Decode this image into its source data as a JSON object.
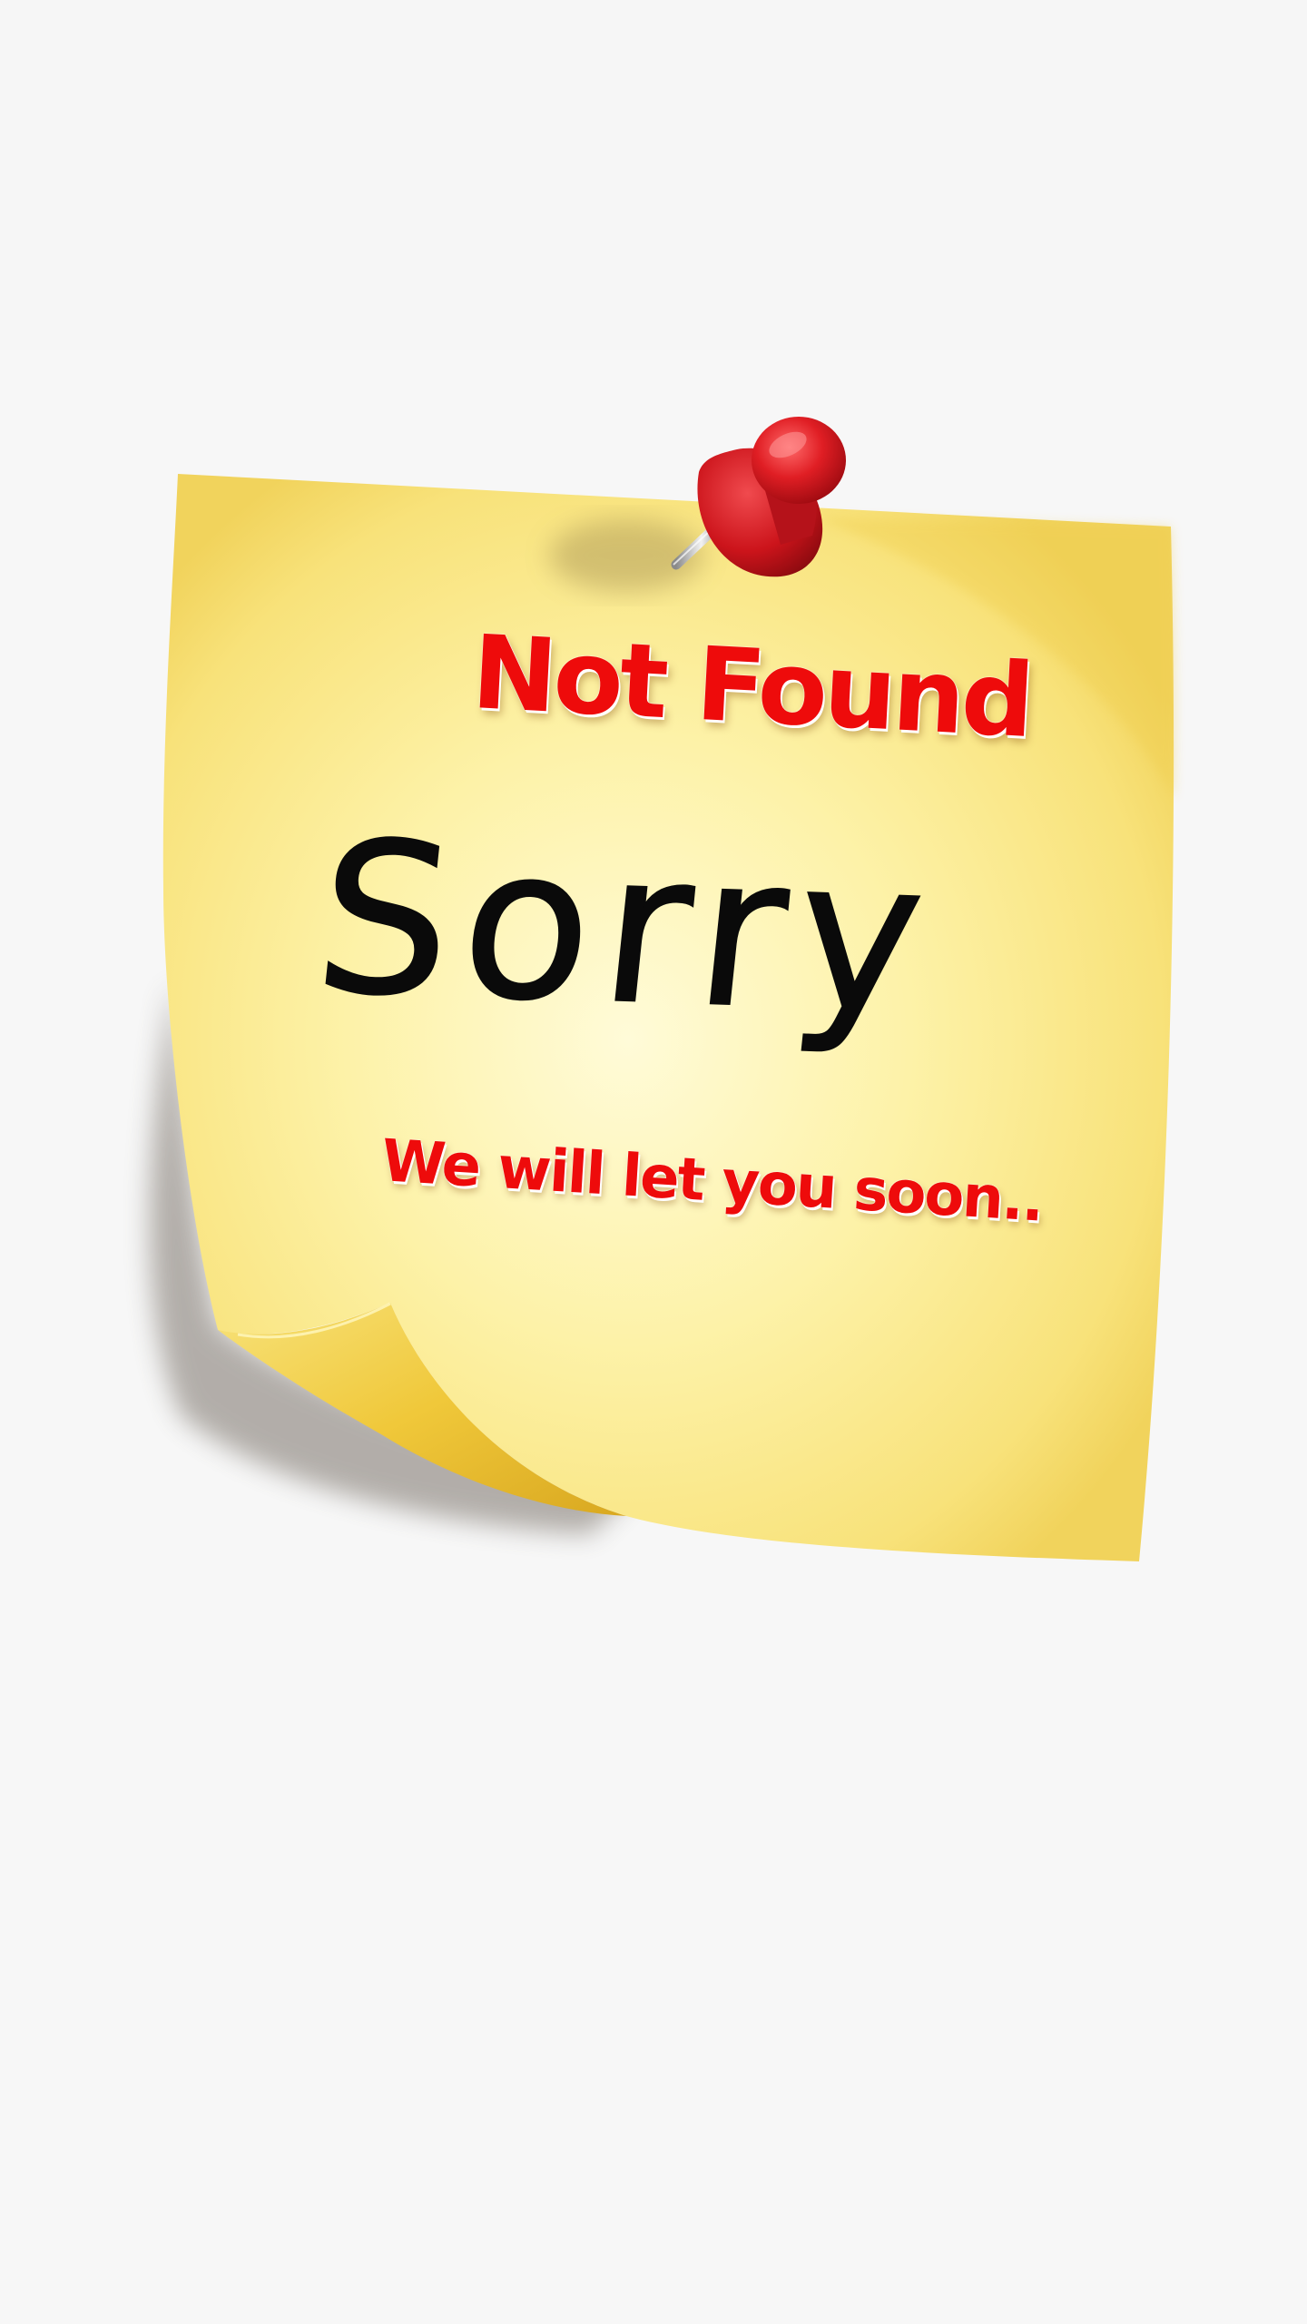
{
  "note": {
    "title": "Not Found",
    "heading": "Sorry",
    "message": "We will let you soon.."
  },
  "colors": {
    "background": "#f7f7f7",
    "note_yellow": "#fbe97a",
    "note_highlight": "#fffbd8",
    "title_red": "#ee0b0b",
    "heading_black": "#0a0a0a",
    "pin_red": "#d8141e"
  },
  "icons": {
    "pin": "push-pin-icon"
  }
}
